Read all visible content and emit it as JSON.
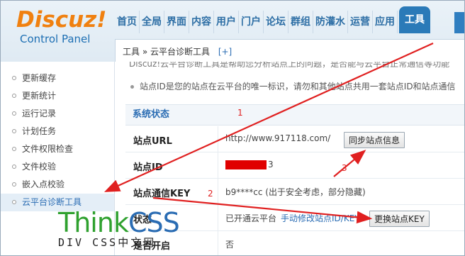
{
  "logo": {
    "title": "Discuz!",
    "subtitle": "Control Panel"
  },
  "nav": {
    "items": [
      "首页",
      "全局",
      "界面",
      "内容",
      "用户",
      "门户",
      "论坛",
      "群组",
      "防灌水",
      "运营",
      "应用"
    ],
    "active": "工具"
  },
  "breadcrumb": {
    "text": "工具 » 云平台诊断工具",
    "add": "[+]"
  },
  "sidebar": {
    "items": [
      "更新缓存",
      "更新统计",
      "运行记录",
      "计划任务",
      "文件权限检查",
      "文件校验",
      "嵌入点校验",
      "云平台诊断工具"
    ],
    "active_index": 7
  },
  "main": {
    "cut_text": "Discuz!云平台诊断工具是帮助您分析站点上的问题，是否能与云平台正常通信等功能",
    "notice": "站点ID是您的站点在云平台的唯一标识，请勿和其他站点共用一套站点ID和站点通信",
    "section_title": "系统状态",
    "rows": [
      {
        "label": "站点URL",
        "value": "http://www.917118.com/",
        "button": "同步站点信息"
      },
      {
        "label": "站点ID",
        "value": "3"
      },
      {
        "label": "站点通信KEY",
        "value": "b9****cc (出于安全考虑，部分隐藏)"
      },
      {
        "label": "状态",
        "value": "已开通云平台",
        "link": "手动修改站点ID/KEY",
        "button": "更换站点KEY"
      },
      {
        "label": "是否开启",
        "value": "否"
      }
    ]
  },
  "watermark": {
    "think": "Think",
    "css": "CSS",
    "sub": "DIV CSS中文网"
  },
  "annotations": [
    "1",
    "2",
    "3"
  ],
  "colors": {
    "accent": "#2a6cb3",
    "logo": "#f08010",
    "arrow": "#e02020",
    "redact": "#e00000"
  }
}
